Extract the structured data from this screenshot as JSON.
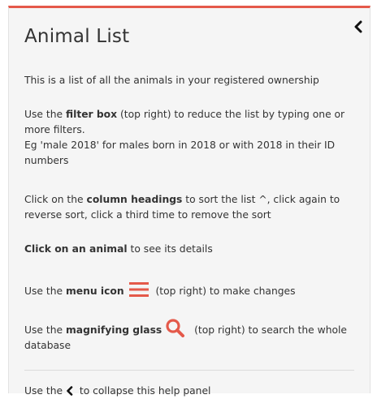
{
  "panel": {
    "title": "Animal List",
    "collapse_icon": "chevron-left-icon",
    "accent_color": "#e4594a"
  },
  "help": {
    "intro": "This is a list of all the animals in your registered ownership",
    "filter_prefix": "Use the ",
    "filter_bold": "filter box",
    "filter_suffix": " (top right) to reduce the list by typing one or more filters.",
    "filter_example": "Eg 'male 2018' for males born in 2018 or with 2018 in their ID numbers",
    "sort_prefix": "Click on the ",
    "sort_bold": "column headings",
    "sort_suffix": " to sort the list ^, click again to reverse sort, click a third time to remove the sort",
    "click_bold": "Click on an animal",
    "click_suffix": " to see its details",
    "menu_prefix": "Use the ",
    "menu_bold": "menu icon",
    "menu_suffix": " (top right) to make changes",
    "menu_icon": "hamburger-menu-icon",
    "search_prefix": "Use the ",
    "search_bold": "magnifying glass",
    "search_suffix": " (top right) to search the whole database",
    "search_icon": "magnifying-glass-icon",
    "collapse_prefix": "Use the ",
    "collapse_suffix": " to collapse this help panel"
  }
}
